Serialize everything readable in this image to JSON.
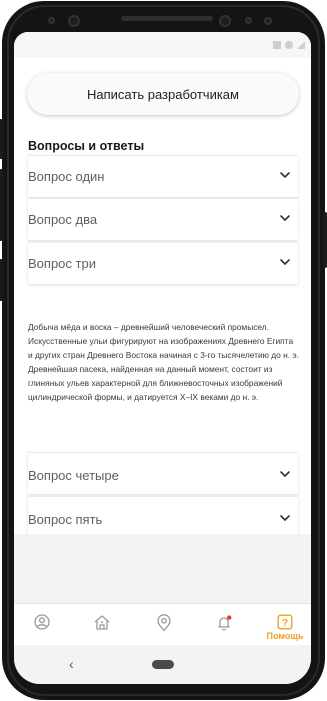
{
  "header": {
    "contact_button_label": "Написать разработчикам"
  },
  "faq": {
    "title": "Вопросы и ответы",
    "items": [
      {
        "label": "Вопрос один",
        "expanded": false
      },
      {
        "label": "Вопрос два",
        "expanded": false
      },
      {
        "label": "Вопрос три",
        "expanded": true
      },
      {
        "label": "Вопрос четыре",
        "expanded": false
      },
      {
        "label": "Вопрос пять",
        "expanded": false
      }
    ],
    "answer_text": "Добыча мёда и воска – древнейший человеческий промысел. Искусственные ульи фигурируют на изображениях Древнего Египта и других стран Древнего Востока начиная с 3-го тысячелетию до н. э. Древнейшая пасека, найденная на данный момент, состоит из глиняных ульев характерной для ближневосточных изображений цилиндрической формы, и датируется X–IX веками до н. э."
  },
  "bottom_nav": {
    "items": [
      {
        "icon": "profile-icon",
        "label": ""
      },
      {
        "icon": "home-icon",
        "label": ""
      },
      {
        "icon": "location-pin-icon",
        "label": ""
      },
      {
        "icon": "bell-icon",
        "label": ""
      },
      {
        "icon": "help-icon",
        "label": "Помощь",
        "active": true
      }
    ],
    "help_icon_text": "?"
  },
  "colors": {
    "accent": "#f0a020",
    "notification_dot": "#e53935",
    "inactive_icon": "#9a9a9a"
  },
  "system_nav": {
    "back_glyph": "‹"
  }
}
